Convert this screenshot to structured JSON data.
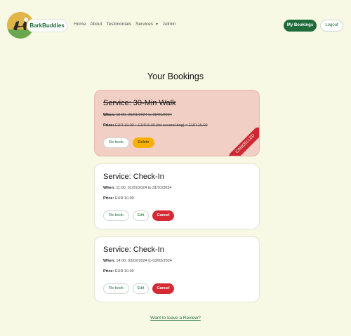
{
  "navbar": {
    "brand": "BarkBuddies",
    "links": [
      "Home",
      "About",
      "Testimonials",
      "Services",
      "Admin"
    ],
    "my_bookings": "My Bookings",
    "logout": "Logout"
  },
  "page": {
    "title": "Your Bookings"
  },
  "bookings": [
    {
      "title": "Service: 30-Min Walk",
      "when_label": "When:",
      "when": "15:00, 25/01/2024 to 25/01/2024",
      "price_label": "Price:",
      "price": "EUR 10.00 + EUR 5.00 (for second dog) = EUR 15.00",
      "status": "CANCELLED",
      "rebook": "Re-book",
      "delete": "Delete"
    },
    {
      "title": "Service: Check-In",
      "when_label": "When:",
      "when": "11:00, 31/01/2024 to 31/01/2024",
      "price_label": "Price:",
      "price": "EUR 10.00",
      "rebook": "Re-book",
      "edit": "Edit",
      "cancel": "Cancel"
    },
    {
      "title": "Service: Check-In",
      "when_label": "When:",
      "when": "14:00, 03/02/2024 to 03/02/2024",
      "price_label": "Price:",
      "price": "EUR 10.00",
      "rebook": "Re-book",
      "edit": "Edit",
      "cancel": "Cancel"
    }
  ],
  "review_link": "Want to leave a Review?"
}
